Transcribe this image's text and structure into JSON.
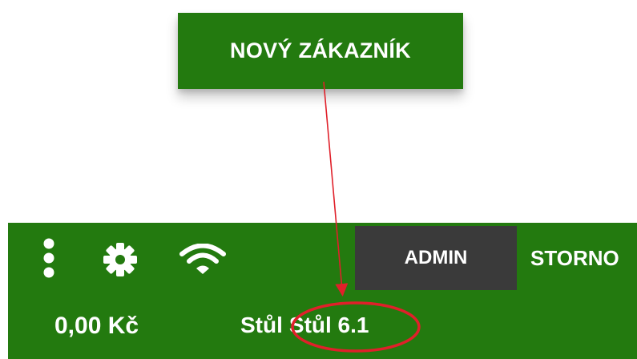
{
  "new_customer_button": {
    "label": "NOVÝ ZÁKAZNÍK"
  },
  "toolbar": {
    "menu_icon": "more-vertical-icon",
    "settings_icon": "gear-icon",
    "wifi_icon": "wifi-icon",
    "admin_label": "ADMIN",
    "storno_label": "STORNO"
  },
  "status": {
    "amount": "0,00 Kč",
    "table_prefix": "Stůl",
    "table_value": "Stůl 6.1"
  },
  "colors": {
    "primary_green": "#237a0f",
    "admin_bg": "#3a3a3a",
    "annotation_red": "#e0202a"
  }
}
